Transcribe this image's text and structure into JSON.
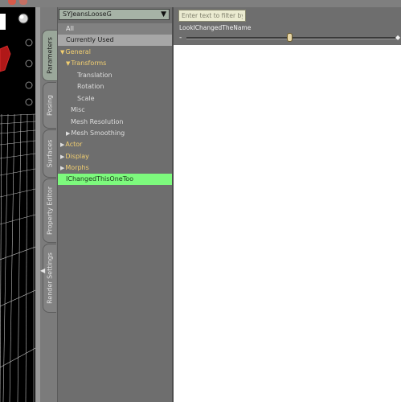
{
  "figure_select": {
    "value": "SYJeansLooseG"
  },
  "tabs": [
    {
      "label": "Parameters",
      "active": true
    },
    {
      "label": "Posing",
      "active": false
    },
    {
      "label": "Surfaces",
      "active": false
    },
    {
      "label": "Property Editor",
      "active": false
    },
    {
      "label": "Render Settings",
      "active": false
    }
  ],
  "tree": {
    "all": "All",
    "currently_used": "Currently Used",
    "general": "General",
    "transforms": "Transforms",
    "translation": "Translation",
    "rotation": "Rotation",
    "scale": "Scale",
    "misc": "Misc",
    "mesh_resolution": "Mesh Resolution",
    "mesh_smoothing": "Mesh Smoothing",
    "actor": "Actor",
    "display": "Display",
    "morphs": "Morphs",
    "selected": "IChangedThisOneToo"
  },
  "filter": {
    "placeholder": "Enter text to filter by..."
  },
  "parameter": {
    "label": "LookIChangedTheName",
    "slider_fraction": 0.49
  },
  "colors": {
    "selected_row": "#7dfa7d",
    "group_text": "#f2cf70",
    "panel_bg": "#6e6e6e",
    "filter_bg": "#ebebd1"
  }
}
